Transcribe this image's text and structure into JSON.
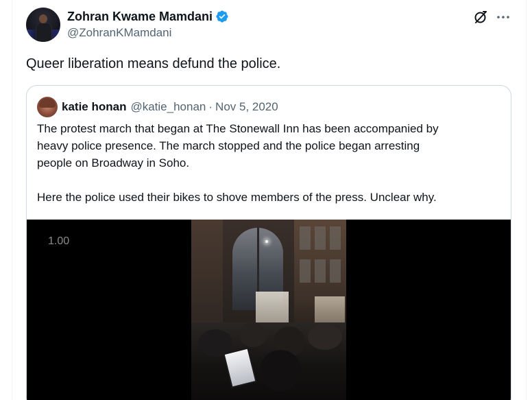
{
  "tweet": {
    "author": {
      "display_name": "Zohran Kwame Mamdani",
      "handle": "@ZohranKMamdani",
      "verified_icon": "verified-badge-icon",
      "verified_color": "#1d9bf0"
    },
    "text": "Queer liberation means defund the police.",
    "actions": {
      "grok_icon": "grok-icon",
      "more_icon": "more-options-icon"
    }
  },
  "quote": {
    "author": {
      "display_name": "katie honan",
      "handle": "@katie_honan",
      "separator": "·",
      "date": "Nov 5, 2020"
    },
    "body": {
      "line1": "The protest march that began at The Stonewall Inn has been accompanied by",
      "line2": "heavy police presence. The march stopped and the police began arresting",
      "line3": "people on Broadway in Soho.",
      "line4": "Here the police used their bikes to shove members of the press. Unclear why."
    },
    "video": {
      "speed_label": "1.00"
    }
  },
  "colors": {
    "text_primary": "#0f1419",
    "text_secondary": "#536471",
    "border": "#cfd9de",
    "accent": "#1d9bf0"
  }
}
